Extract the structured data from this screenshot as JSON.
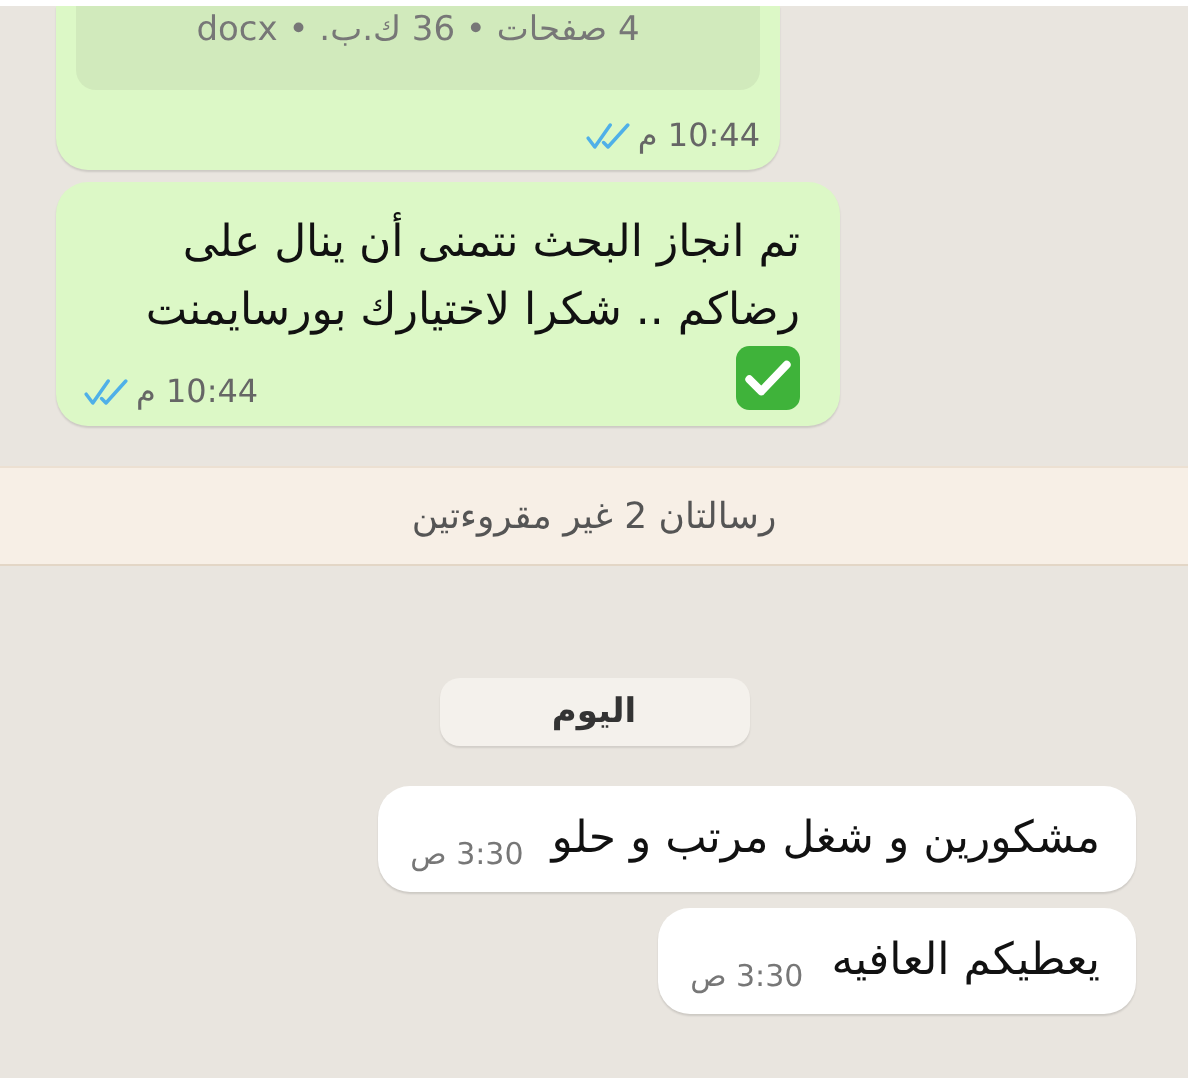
{
  "messages": [
    {
      "kind": "document",
      "meta": "4 صفحات • 36 ك.ب. • docx",
      "time": "10:44 م",
      "read": true
    },
    {
      "kind": "outgoing",
      "text": "تم انجاز البحث نتمنى أن ينال على رضاكم .. شكرا لاختيارك بورسايمنت",
      "emoji": true,
      "time": "10:44 م",
      "read": true
    },
    {
      "kind": "unread",
      "text": "رسالتان 2 غير مقروءتين"
    },
    {
      "kind": "date",
      "text": "اليوم"
    },
    {
      "kind": "incoming",
      "text": "مشكورين و شغل مرتب و حلو",
      "time": "3:30 ص"
    },
    {
      "kind": "incoming",
      "text": "يعطيكم العافيه",
      "time": "3:30 ص"
    }
  ]
}
